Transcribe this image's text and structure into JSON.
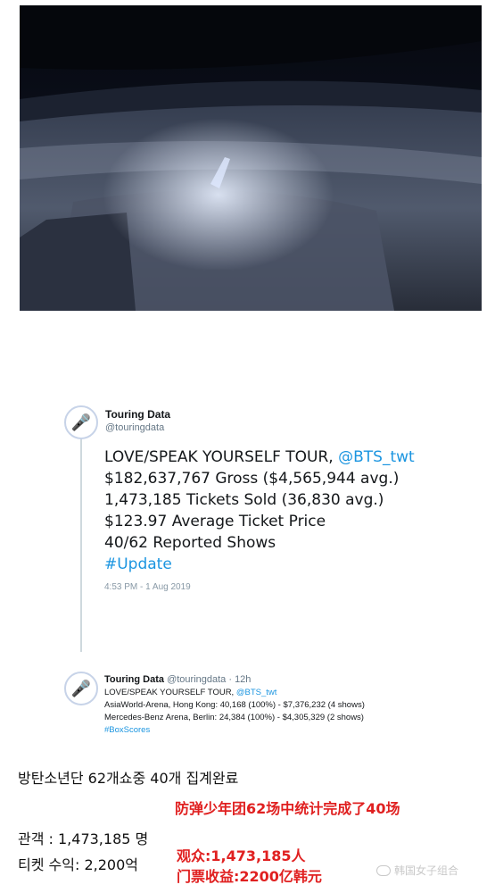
{
  "photo": {
    "description_icon": "stadium-concert-photo"
  },
  "tweet": {
    "author_name": "Touring Data",
    "author_handle": "@touringdata",
    "line1_text": "LOVE/SPEAK YOURSELF TOUR, ",
    "line1_mention": "@BTS_twt",
    "line2": "$182,637,767 Gross ($4,565,944 avg.)",
    "line3": "1,473,185 Tickets Sold (36,830 avg.)",
    "line4": "$123.97 Average Ticket Price",
    "line5": "40/62 Reported Shows",
    "hashtag": "#Update",
    "timestamp": "4:53 PM - 1 Aug 2019"
  },
  "reply": {
    "author_name": "Touring Data",
    "meta": "@touringdata · 12h",
    "line1_text": "LOVE/SPEAK YOURSELF TOUR, ",
    "line1_mention": "@BTS_twt",
    "line2": "AsiaWorld-Arena, Hong Kong: 40,168 (100%) - $7,376,232 (4 shows)",
    "line3": "Mercedes-Benz Arena, Berlin: 24,384 (100%) - $4,305,329 (2 shows)",
    "hashtag": "#BoxScores"
  },
  "captions": {
    "ko_line1": "방탄소년단 62개쇼중 40개 집계완료",
    "cn_line1": "防弹少年团62场中统计完成了40场",
    "ko_line2": "관객 : 1,473,185 명",
    "ko_line3": "티켓 수익: 2,200억",
    "cn_line2": "观众:1,473,185人",
    "cn_line3": "门票收益:2200亿韩元"
  },
  "watermark": {
    "text": "韩国女子组合"
  },
  "colors": {
    "link": "#1b95e0",
    "caption_red": "#e02020"
  }
}
